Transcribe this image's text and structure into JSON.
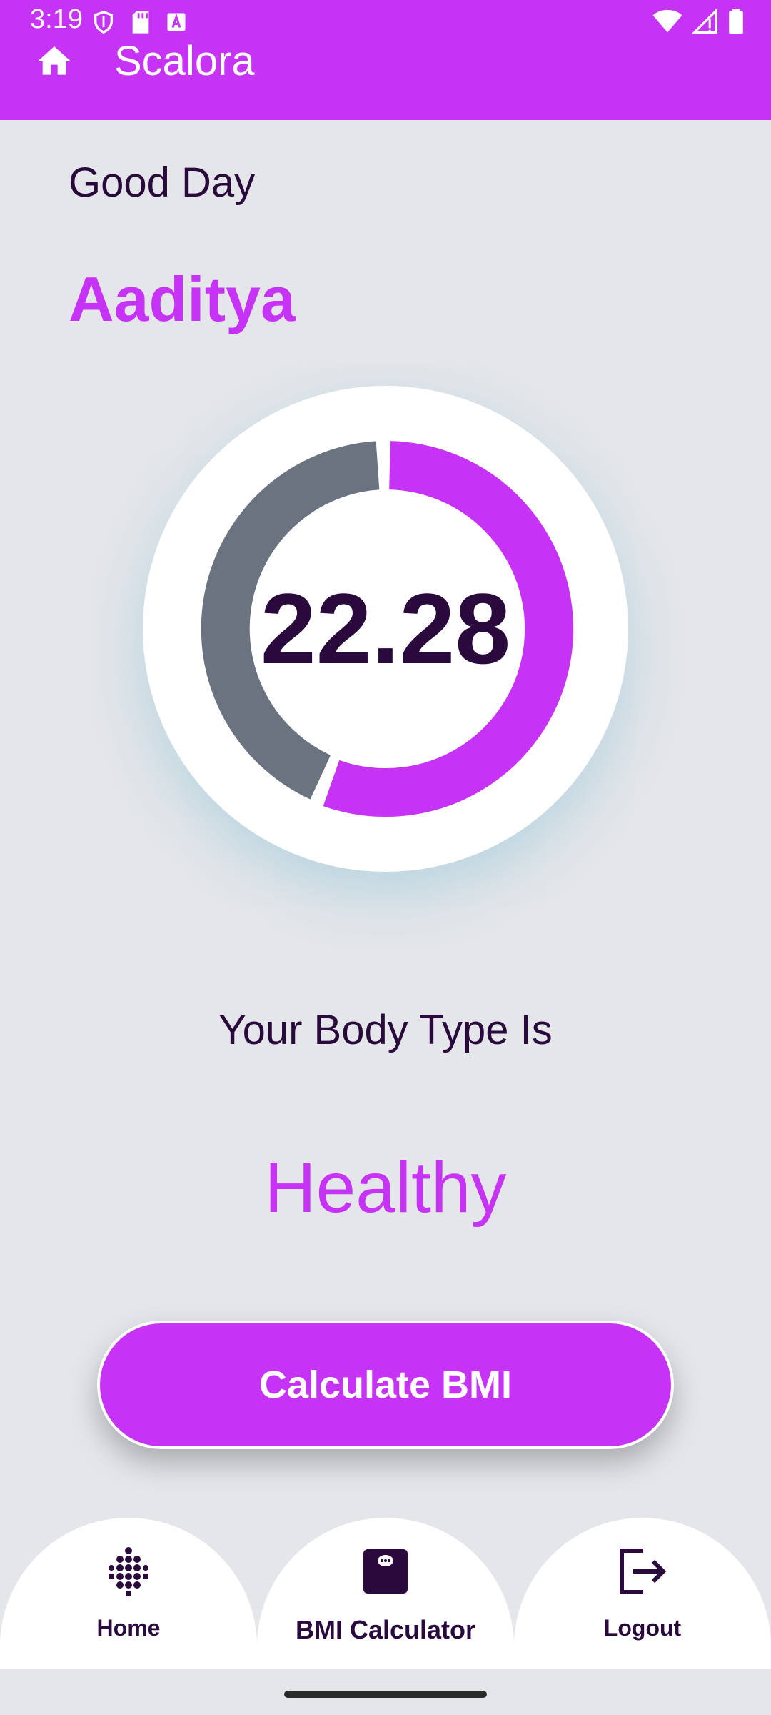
{
  "status_bar": {
    "time": "3:19"
  },
  "app_bar": {
    "title": "Scalora"
  },
  "greeting": "Good Day",
  "user_name": "Aaditya",
  "bmi": {
    "value": "22.28"
  },
  "body_type": {
    "label": "Your Body Type Is",
    "value": "Healthy"
  },
  "calculate_button": {
    "label": "Calculate BMI"
  },
  "bottom_nav": {
    "items": [
      {
        "label": "Home",
        "icon": "dots-grid-icon",
        "active": false
      },
      {
        "label": "BMI Calculator",
        "icon": "scale-icon",
        "active": true
      },
      {
        "label": "Logout",
        "icon": "logout-icon",
        "active": false
      }
    ]
  },
  "colors": {
    "accent": "#c633f5",
    "dark": "#2a0a3d",
    "gray_arc": "#6b7280",
    "background": "#e4e6ea"
  }
}
